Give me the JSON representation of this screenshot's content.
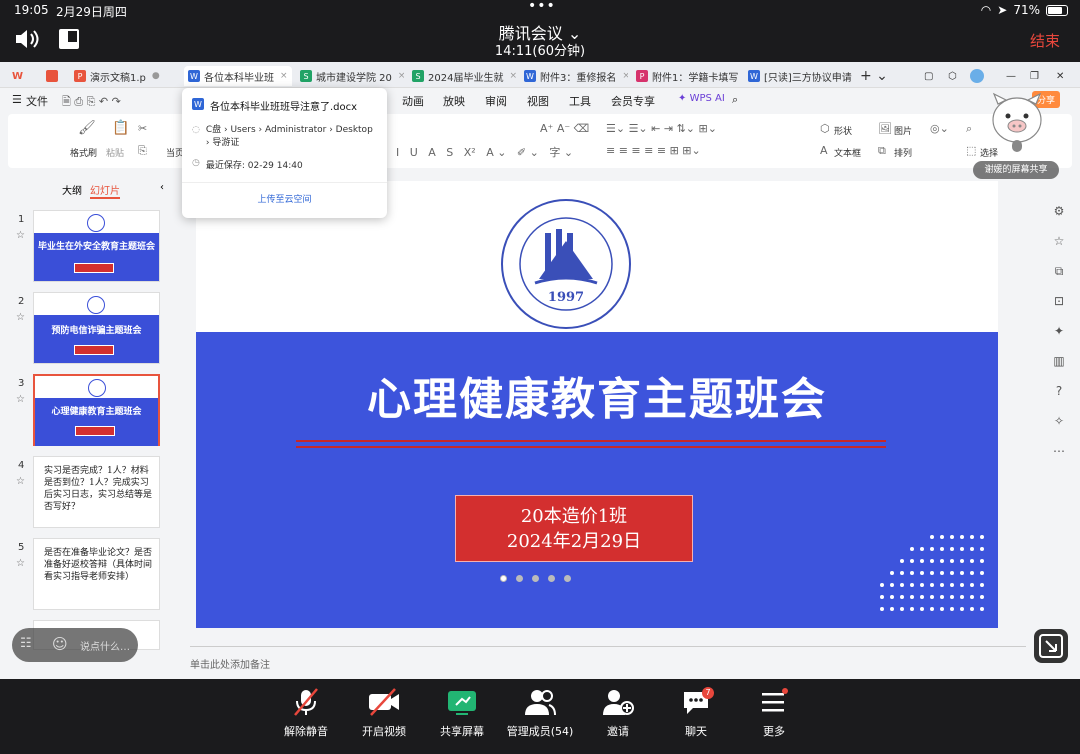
{
  "status": {
    "time": "19:05",
    "date": "2月29日周四",
    "battery": "71%"
  },
  "meeting": {
    "title": "腾讯会议",
    "duration": "14:11(60分钟)",
    "end_label": "结束"
  },
  "wps": {
    "tabs": [
      {
        "label": "演示文稿1.p",
        "color": "#e8543d",
        "icon": "P"
      },
      {
        "label": "各位本科毕业班",
        "color": "#2f66d6",
        "icon": "W"
      },
      {
        "label": "城市建设学院 20",
        "color": "#21a366",
        "icon": "S"
      },
      {
        "label": "2024届毕业生就",
        "color": "#21a366",
        "icon": "S"
      },
      {
        "label": "附件3：重修报名",
        "color": "#2f66d6",
        "icon": "W"
      },
      {
        "label": "附件1：学籍卡填写",
        "color": "#d6336c",
        "icon": "P"
      },
      {
        "label": "[只读]三方协议申请",
        "color": "#2f66d6",
        "icon": "W"
      }
    ],
    "menu": [
      {
        "label": "文件"
      },
      {
        "label": "动画"
      },
      {
        "label": "放映"
      },
      {
        "label": "审阅"
      },
      {
        "label": "视图"
      },
      {
        "label": "工具"
      },
      {
        "label": "会员专享"
      },
      {
        "label": "WPS AI"
      }
    ],
    "share_button": "分享",
    "ribbon": {
      "format_painter": "格式刷",
      "paste": "粘贴",
      "current": "当页",
      "shape": "形状",
      "picture": "图片",
      "textbox": "文本框",
      "arrange": "排列",
      "select": "选择"
    }
  },
  "popup": {
    "file_name": "各位本科毕业班班导注意了.docx",
    "path": "C盘 › Users › Administrator › Desktop › 导游证",
    "last_saved": "最近保存: 02-29 14:40",
    "upload": "上传至云空间"
  },
  "left_panel": {
    "tab_outline": "大纲",
    "tab_slides": "幻灯片",
    "slides": [
      {
        "num": "1",
        "title": "毕业生在外安全教育主题班会"
      },
      {
        "num": "2",
        "title": "预防电信诈骗主题班会"
      },
      {
        "num": "3",
        "title": "心理健康教育主题班会"
      },
      {
        "num": "4",
        "text": "实习是否完成？1人？材料是否到位？1人？完成实习后实习日志，实习总结等是否写好？"
      },
      {
        "num": "5",
        "text": "是否在准备毕业论文？是否准备好返校答辩（具体时间看实习指导老师安排）"
      }
    ]
  },
  "slide": {
    "title": "心理健康教育主题班会",
    "class_name": "20本造价1班",
    "date": "2024年2月29日",
    "logo_year": "1997"
  },
  "notes_placeholder": "单击此处添加备注",
  "share_label": "谢媛的屏幕共享",
  "chat_placeholder": "说点什么…",
  "toolbar": [
    {
      "label": "解除静音"
    },
    {
      "label": "开启视频"
    },
    {
      "label": "共享屏幕"
    },
    {
      "label": "管理成员(54)"
    },
    {
      "label": "邀请"
    },
    {
      "label": "聊天",
      "badge": "7"
    },
    {
      "label": "更多"
    }
  ],
  "colors": {
    "accent_red": "#e8473c",
    "slide_blue": "#3d54dc",
    "slide_red": "#d32f2f",
    "share_green": "#22b573"
  }
}
